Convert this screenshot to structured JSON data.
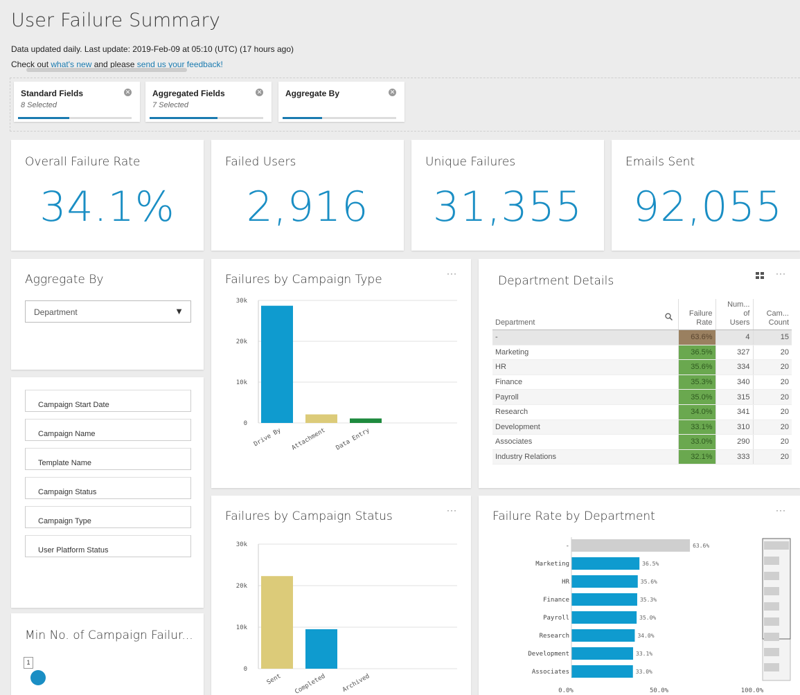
{
  "page": {
    "title": "User Failure Summary",
    "update_line": "Data updated daily. Last update: 2019-Feb-09 at 05:10 (UTC) (17 hours ago)",
    "feedback_prefix": "Check out ",
    "whats_new_link": "what's new",
    "feedback_mid": " and please ",
    "feedback_link": "send us your feedback!"
  },
  "filters": [
    {
      "label": "Standard Fields",
      "sub": "8 Selected",
      "progress": 0.45
    },
    {
      "label": "Aggregated Fields",
      "sub": "7 Selected",
      "progress": 0.6
    },
    {
      "label": "Aggregate By",
      "sub": "",
      "progress": 0.35
    }
  ],
  "kpis": [
    {
      "label": "Overall Failure Rate",
      "value": "34.1%"
    },
    {
      "label": "Failed Users",
      "value": "2,916"
    },
    {
      "label": "Unique Failures",
      "value": "31,355"
    },
    {
      "label": "Emails Sent",
      "value": "92,055"
    }
  ],
  "aggregate_by": {
    "title": "Aggregate By",
    "selected": "Department"
  },
  "fields_list": [
    "Campaign Start Date",
    "Campaign Name",
    "Template Name",
    "Campaign Status",
    "Campaign Type",
    "User Platform Status"
  ],
  "min_failures": {
    "title": "Min No. of Campaign Failur...",
    "value": "1",
    "level": 0.05
  },
  "department_details": {
    "title": "Department Details",
    "headers": {
      "department": "Department",
      "failure_rate": [
        "Failure",
        "Rate"
      ],
      "num_users": [
        "Num...",
        "of",
        "Users"
      ],
      "cam_count": [
        "Cam...",
        "Count"
      ]
    },
    "rows": [
      {
        "name": "-",
        "rate": "63.6%",
        "users": "4",
        "count": "15"
      },
      {
        "name": "Marketing",
        "rate": "36.5%",
        "users": "327",
        "count": "20"
      },
      {
        "name": "HR",
        "rate": "35.6%",
        "users": "334",
        "count": "20"
      },
      {
        "name": "Finance",
        "rate": "35.3%",
        "users": "340",
        "count": "20"
      },
      {
        "name": "Payroll",
        "rate": "35.0%",
        "users": "315",
        "count": "20"
      },
      {
        "name": "Research",
        "rate": "34.0%",
        "users": "341",
        "count": "20"
      },
      {
        "name": "Development",
        "rate": "33.1%",
        "users": "310",
        "count": "20"
      },
      {
        "name": "Associates",
        "rate": "33.0%",
        "users": "290",
        "count": "20"
      },
      {
        "name": "Industry Relations",
        "rate": "32.1%",
        "users": "333",
        "count": "20"
      }
    ]
  },
  "chart_titles": {
    "campaign_type": "Failures by Campaign Type",
    "campaign_status": "Failures by Campaign Status",
    "rate_by_department": "Failure Rate by Department"
  },
  "menu_dots": "···",
  "chart_data": [
    {
      "type": "bar",
      "title": "Failures by Campaign Type",
      "categories": [
        "Drive By",
        "Attachment",
        "Data Entry"
      ],
      "values": [
        28700,
        2100,
        1100
      ],
      "colors": [
        "#0f9bcf",
        "#dccb79",
        "#1e8a3e"
      ],
      "yticks": [
        "0",
        "10k",
        "20k",
        "30k"
      ],
      "ylim": [
        0,
        30000
      ]
    },
    {
      "type": "bar",
      "title": "Failures by Campaign Status",
      "categories": [
        "Sent",
        "Completed",
        "Archived"
      ],
      "values": [
        22300,
        9500,
        0
      ],
      "colors": [
        "#dccb79",
        "#0f9bcf",
        "#0f9bcf"
      ],
      "yticks": [
        "0",
        "10k",
        "20k",
        "30k"
      ],
      "ylim": [
        0,
        30000
      ]
    },
    {
      "type": "bar",
      "title": "Failure Rate by Department",
      "orientation": "horizontal",
      "categories": [
        "-",
        "Marketing",
        "HR",
        "Finance",
        "Payroll",
        "Research",
        "Development",
        "Associates"
      ],
      "values": [
        63.6,
        36.5,
        35.6,
        35.3,
        35.0,
        34.0,
        33.1,
        33.0
      ],
      "labels": [
        "63.6%",
        "36.5%",
        "35.6%",
        "35.3%",
        "35.0%",
        "34.0%",
        "33.1%",
        "33.0%"
      ],
      "colors": [
        "#cfcfcf",
        "#0f9bcf",
        "#0f9bcf",
        "#0f9bcf",
        "#0f9bcf",
        "#0f9bcf",
        "#0f9bcf",
        "#0f9bcf"
      ],
      "xticks": [
        "0.0%",
        "50.0%",
        "100.0%"
      ],
      "xlim": [
        0,
        100
      ]
    }
  ]
}
